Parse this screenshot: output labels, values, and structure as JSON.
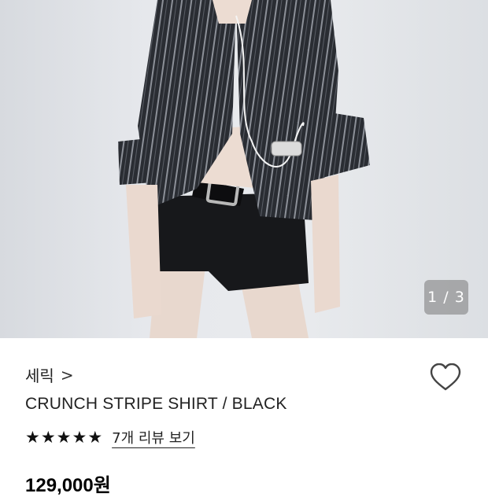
{
  "product": {
    "image_counter": "1 / 3",
    "brand": "세릭",
    "brand_chevron": ">",
    "title": "CRUNCH STRIPE SHIRT / BLACK",
    "rating": 5,
    "review_link": "7개 리뷰 보기",
    "price": "129,000원"
  },
  "icons": {
    "heart": "heart-outline-icon",
    "star": "star-filled-icon",
    "chevron": "chevron-right-icon"
  },
  "colors": {
    "text": "#222222",
    "counter_bg": "#8a8a8a",
    "photo_bg": "#e6e8ec"
  }
}
